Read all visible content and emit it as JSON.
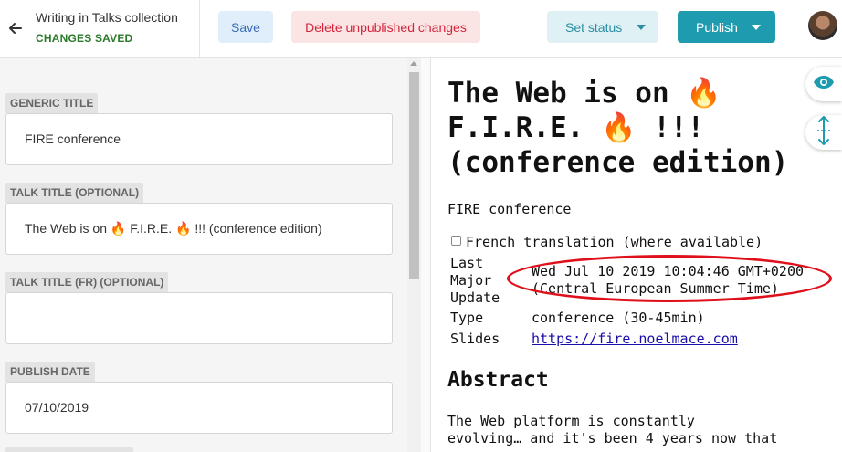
{
  "header": {
    "collection": "Writing in Talks collection",
    "status": "CHANGES SAVED",
    "save_label": "Save",
    "delete_label": "Delete unpublished changes",
    "set_status_label": "Set status",
    "publish_label": "Publish"
  },
  "fields": [
    {
      "label": "GENERIC TITLE",
      "value": "FIRE conference"
    },
    {
      "label": "TALK TITLE (OPTIONAL)",
      "value": "The Web is on 🔥 F.I.R.E. 🔥 !!! (conference edition)"
    },
    {
      "label": "TALK TITLE (FR) (OPTIONAL)",
      "value": ""
    },
    {
      "label": "PUBLISH DATE",
      "value": "07/10/2019"
    }
  ],
  "preview": {
    "title_line1": "The Web is on 🔥",
    "title_line2": "F.I.R.E. 🔥 !!!",
    "title_line3": "(conference edition)",
    "generic_title": "FIRE conference",
    "french_label": "French translation (where available)",
    "rows": {
      "last_update_label_1": "Last",
      "last_update_label_2": "Major",
      "last_update_label_3": "Update",
      "last_update_value_1": "Wed Jul 10 2019 10:04:46 GMT+0200",
      "last_update_value_2": "(Central European Summer Time)",
      "type_label": "Type",
      "type_value": "conference (30-45min)",
      "slides_label": "Slides",
      "slides_value": "https://fire.noelmace.com"
    },
    "abstract_heading": "Abstract",
    "abstract_line1": "The Web platform is constantly",
    "abstract_line2": "evolving… and it's been 4 years now that"
  },
  "colors": {
    "accent": "#1f9bb0",
    "delete": "#d4243a",
    "saved": "#2b7a2b",
    "highlight": "#e0101b"
  }
}
